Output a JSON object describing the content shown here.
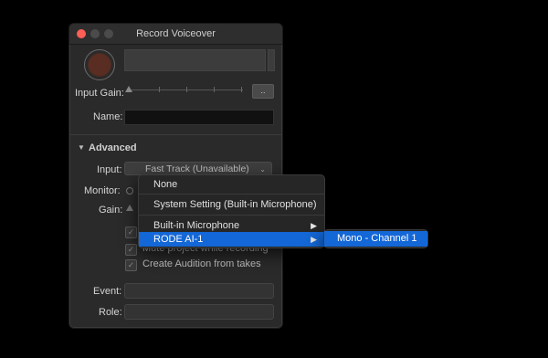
{
  "window": {
    "title": "Record Voiceover"
  },
  "record": {
    "input_gain_label": "Input Gain:",
    "gain_button_label": "..",
    "name_label": "Name:",
    "name_value": ""
  },
  "advanced": {
    "label": "Advanced",
    "input_label": "Input:",
    "input_value": "Fast Track (Unavailable)",
    "monitor_label": "Monitor:",
    "gain_label": "Gain:",
    "checkboxes": [
      {
        "label": "",
        "checked": true
      },
      {
        "label": "Mute project while recording",
        "checked": true
      },
      {
        "label": "Create Audition from takes",
        "checked": true
      }
    ],
    "event_label": "Event:",
    "event_value": "",
    "role_label": "Role:",
    "role_value": ""
  },
  "input_menu": {
    "items": [
      {
        "label": "None"
      },
      {
        "label": "System Setting (Built-in Microphone)"
      },
      {
        "label": "Built-in Microphone",
        "submenu": true
      },
      {
        "label": "RODE AI-1",
        "submenu": true,
        "selected": true
      }
    ],
    "submenu_items": [
      {
        "label": "Mono - Channel 1",
        "selected": true
      }
    ]
  },
  "colors": {
    "selection_blue": "#1467d6",
    "close_button": "#fd5f57"
  }
}
